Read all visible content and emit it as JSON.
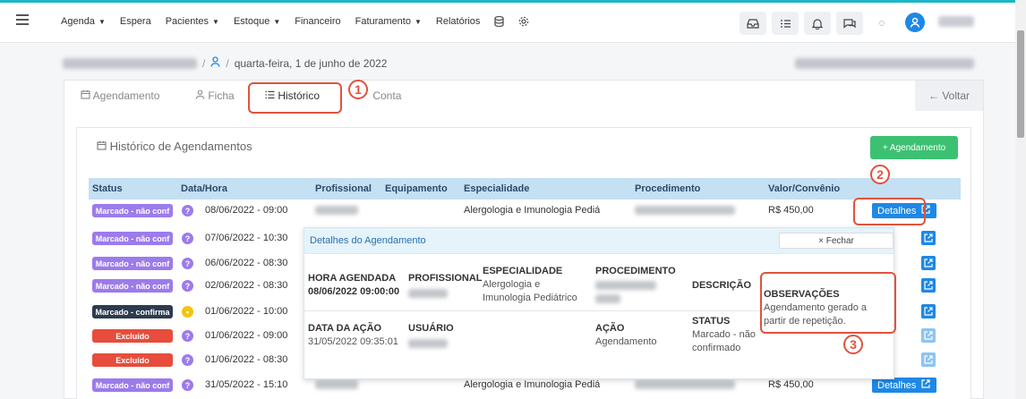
{
  "topbar": {
    "menu": [
      {
        "label": "Agenda",
        "caret": true
      },
      {
        "label": "Espera",
        "caret": false
      },
      {
        "label": "Pacientes",
        "caret": true
      },
      {
        "label": "Estoque",
        "caret": true
      },
      {
        "label": "Financeiro",
        "caret": false
      },
      {
        "label": "Faturamento",
        "caret": true
      },
      {
        "label": "Relatórios",
        "caret": false
      }
    ],
    "caret_glyph": "▼",
    "database_icon": "database-icon",
    "settings_icon": "gear-icon",
    "right_icons": [
      "inbox-icon",
      "checklist-icon",
      "bell-icon",
      "chat-icon"
    ],
    "avatar_icon": "user-icon"
  },
  "breadcrumb": {
    "separator": "/",
    "date": "quarta-feira, 1 de junho de 2022"
  },
  "tabs": [
    {
      "label": "Agendamento",
      "icon": "calendar-icon"
    },
    {
      "label": "Ficha",
      "icon": "person-icon"
    },
    {
      "label": "Histórico",
      "icon": "list-icon"
    },
    {
      "label": "Conta",
      "icon": "card-icon"
    }
  ],
  "voltar_label": "← Voltar",
  "annotations": [
    "1",
    "2",
    "3"
  ],
  "historico": {
    "title": "Histórico de Agendamentos",
    "add_button": "+ Agendamento",
    "columns": [
      "Status",
      "Data/Hora",
      "Profissional",
      "Equipamento",
      "Especialidade",
      "Procedimento",
      "Valor/Convênio"
    ],
    "rows": [
      {
        "status": "Marcado - não conf",
        "status_color": "#9c7bea",
        "icon": "?",
        "icon_color": "#9c7bea",
        "datetime": "08/06/2022 - 09:00",
        "especialidade": "Alergologia e Imunologia Pediá",
        "valor": "R$ 450,00",
        "action": "Detalhes"
      },
      {
        "status": "Marcado - não conf",
        "status_color": "#9c7bea",
        "icon": "?",
        "icon_color": "#9c7bea",
        "datetime": "07/06/2022 - 10:30"
      },
      {
        "status": "Marcado - não conf",
        "status_color": "#9c7bea",
        "icon": "?",
        "icon_color": "#9c7bea",
        "datetime": "06/06/2022 - 08:30"
      },
      {
        "status": "Marcado - não conf",
        "status_color": "#9c7bea",
        "icon": "?",
        "icon_color": "#9c7bea",
        "datetime": "02/06/2022 - 08:30"
      },
      {
        "status": "Marcado - confirma",
        "status_color": "#2d3b4f",
        "icon": "•",
        "icon_color": "#f2c40f",
        "datetime": "01/06/2022 - 10:00"
      },
      {
        "status": "Excluído",
        "status_color": "#e74c3c",
        "icon": "?",
        "icon_color": "#9c7bea",
        "datetime": "01/06/2022 - 09:00"
      },
      {
        "status": "Excluído",
        "status_color": "#e74c3c",
        "icon": "?",
        "icon_color": "#9c7bea",
        "datetime": "01/06/2022 - 08:30"
      },
      {
        "status": "Marcado - não conf",
        "status_color": "#9c7bea",
        "icon": "?",
        "icon_color": "#9c7bea",
        "datetime": "31/05/2022 - 15:10",
        "especialidade": "Alergologia e Imunologia Pediá",
        "valor": "R$ 450,00",
        "action": "Detalhes"
      }
    ]
  },
  "popup": {
    "title": "Detalhes do Agendamento",
    "close_label": "× Fechar",
    "hora_label": "HORA AGENDADA",
    "hora_value": "08/06/2022 09:00:00",
    "profissional_label": "PROFISSIONAL",
    "especialidade_label": "ESPECIALIDADE",
    "especialidade_value": "Alergologia e Imunologia Pediátrico",
    "procedimento_label": "PROCEDIMENTO",
    "descricao_label": "DESCRIÇÃO",
    "observacoes_label": "OBSERVAÇÕES",
    "observacoes_value": "Agendamento gerado a partir de repetição.",
    "data_acao_label": "DATA DA AÇÃO",
    "data_acao_value": "31/05/2022 09:35:01",
    "usuario_label": "USUÁRIO",
    "acao_label": "AÇÃO",
    "acao_value": "Agendamento",
    "status_label": "STATUS",
    "status_value": "Marcado - não confirmado"
  }
}
